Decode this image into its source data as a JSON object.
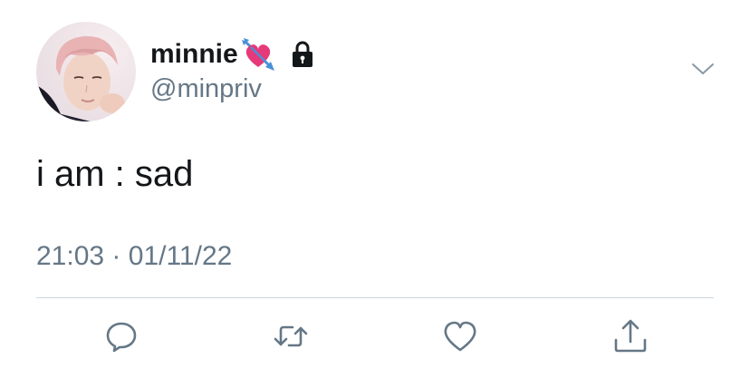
{
  "tweet": {
    "display_name": "minnie",
    "name_emoji": "heart-with-arrow",
    "protected_icon": "lock-icon",
    "handle": "@minpriv",
    "text": "i am : sad",
    "time": "21:03",
    "separator": "·",
    "date": "01/11/22"
  },
  "actions": [
    {
      "name": "reply",
      "icon": "speech-bubble-icon"
    },
    {
      "name": "retweet",
      "icon": "retweet-arrows-icon"
    },
    {
      "name": "like",
      "icon": "heart-icon"
    },
    {
      "name": "share",
      "icon": "share-upload-icon"
    }
  ],
  "colors": {
    "text_primary": "#14171a",
    "text_secondary": "#657786",
    "divider": "#ccd6dd",
    "icon": "#657786",
    "heart_emoji": "#e6397a",
    "arrow_emoji": "#4a90d9"
  }
}
